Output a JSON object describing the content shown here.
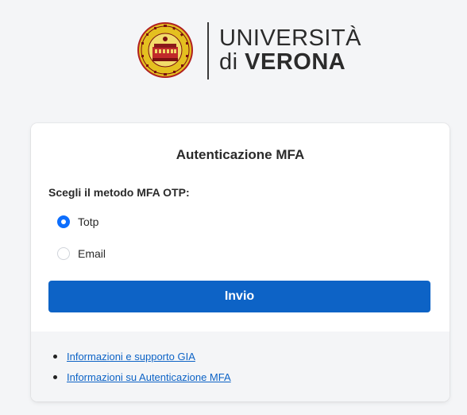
{
  "logo": {
    "line1": "UNIVERSITÀ",
    "line2_prefix": "di ",
    "line2_main": "VERONA"
  },
  "card": {
    "title": "Autenticazione MFA",
    "method_label": "Scegli il metodo MFA OTP:",
    "options": [
      {
        "label": "Totp",
        "selected": true
      },
      {
        "label": "Email",
        "selected": false
      }
    ],
    "submit_label": "Invio"
  },
  "footer": {
    "links": [
      {
        "label": "Informazioni e supporto GIA"
      },
      {
        "label": "Informazioni su Autenticazione MFA"
      }
    ]
  },
  "colors": {
    "primary": "#0d63c6",
    "radio_checked": "#0d6efd",
    "page_background": "#f4f5f7",
    "seal_gold": "#e4c020",
    "seal_red": "#b02020"
  },
  "icons": {
    "logo": "university-seal-icon",
    "bullet": "bullet-icon"
  }
}
